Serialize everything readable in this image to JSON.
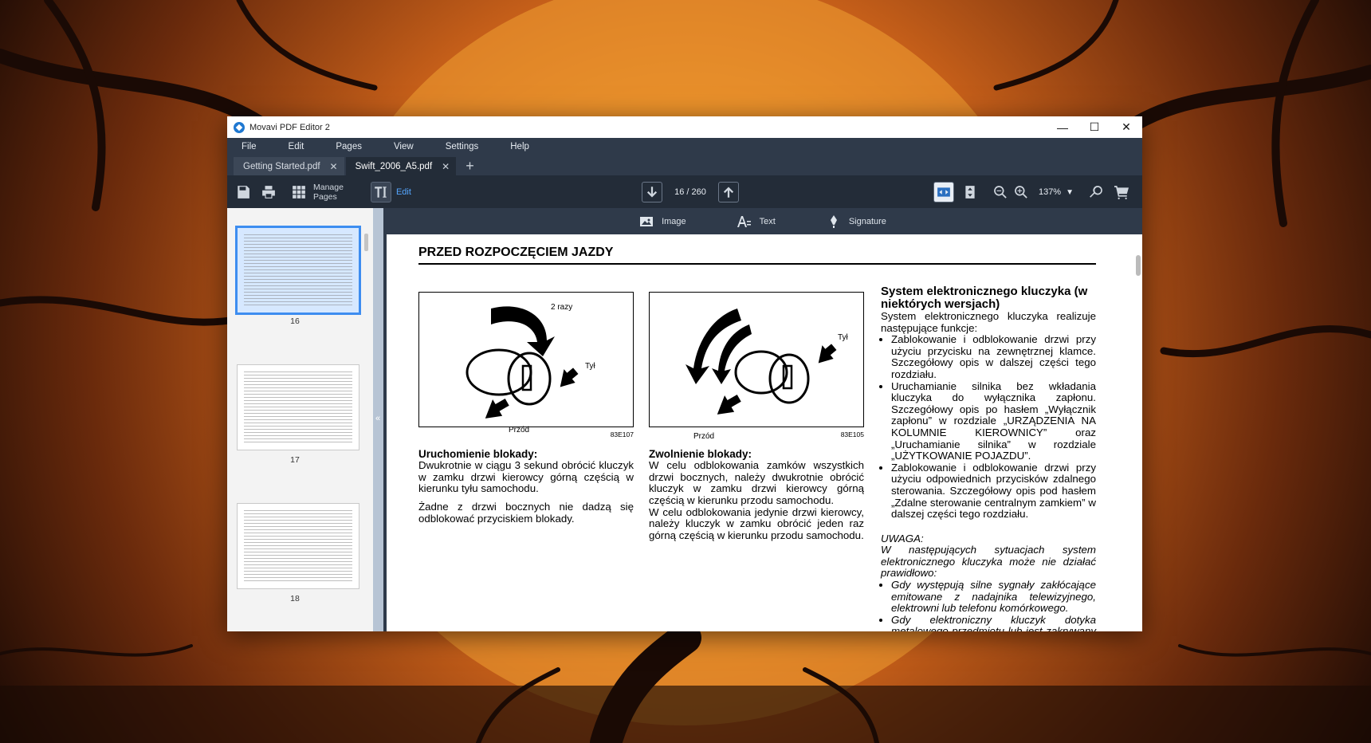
{
  "window": {
    "title": "Movavi PDF Editor 2",
    "controls": {
      "minimize": "—",
      "maximize": "☐",
      "close": "✕"
    }
  },
  "menu": [
    "File",
    "Edit",
    "Pages",
    "View",
    "Settings",
    "Help"
  ],
  "tabs": [
    {
      "label": "Getting Started.pdf",
      "active": false
    },
    {
      "label": "Swift_2006_A5.pdf",
      "active": true
    }
  ],
  "toolbar": {
    "manage_pages_line1": "Manage",
    "manage_pages_line2": "Pages",
    "edit_label": "Edit",
    "page_count": "16 / 260",
    "zoom": "137%"
  },
  "edit_tools": {
    "image": "Image",
    "text": "Text",
    "signature": "Signature"
  },
  "thumbnails": [
    {
      "page": "16",
      "selected": true
    },
    {
      "page": "17",
      "selected": false
    },
    {
      "page": "18",
      "selected": false
    }
  ],
  "pdf": {
    "title": "PRZED ROZPOCZĘCIEM JAZDY",
    "fig1": {
      "label_top": "2 razy",
      "label_back": "Tył",
      "label_front": "Przód",
      "code": "83E107"
    },
    "fig2": {
      "label_back": "Tył",
      "label_front": "Przód",
      "code": "83E105"
    },
    "col1_heading": "Uruchomienie blokady:",
    "col1_p1": "Dwukrotnie w ciągu 3 sekund obrócić kluczyk w zamku drzwi kierowcy górną częścią w kierunku tyłu samochodu.",
    "col1_p2": "Żadne z drzwi bocznych nie dadzą się odblokować przyciskiem blokady.",
    "col2_heading": "Zwolnienie blokady:",
    "col2_p1": "W celu odblokowania zamków wszystkich drzwi bocznych, należy dwukrotnie obrócić kluczyk w zamku drzwi kierowcy górną częścią w kierunku przodu samochodu.",
    "col2_p2": "W celu odblokowania jedynie drzwi kierowcy, należy kluczyk w zamku obrócić jeden raz górną częścią w kierunku przodu samochodu.",
    "col3_heading": "System elektronicznego kluczyka (w niektórych wersjach)",
    "col3_intro": "System elektronicznego kluczyka realizuje następujące funkcje:",
    "col3_bullets": [
      "Zablokowanie i odblokowanie drzwi przy użyciu przycisku na zewnętrznej klamce. Szczegółowy opis w dalszej części tego rozdziału.",
      "Uruchamianie silnika bez wkładania kluczyka do wyłącznika zapłonu. Szczegółowy opis po hasłem „Wyłącznik zapłonu” w rozdziale „URZĄDZENIA NA KOLUMNIE KIEROWNICY” oraz „Uruchamianie silnika” w rozdziale „UŻYTKOWANIE POJAZDU”.",
      "Zablokowanie i odblokowanie drzwi przy użyciu odpowiednich przycisków zdalnego sterowania. Szczegółowy opis pod hasłem „Zdalne sterowanie centralnym zamkiem” w dalszej części tego rozdziału."
    ],
    "col3_note_title": "UWAGA:",
    "col3_note_intro": "W następujących sytuacjach system elektronicznego kluczyka może nie działać prawidłowo:",
    "col3_note_bullets": [
      "Gdy występują silne sygnały zakłócające emitowane z nadajnika telewizyjnego, elektrowni lub telefonu komórkowego.",
      "Gdy elektroniczny kluczyk dotyka metalowego przedmiotu lub jest zakrywany przez taki przedmiot."
    ]
  }
}
